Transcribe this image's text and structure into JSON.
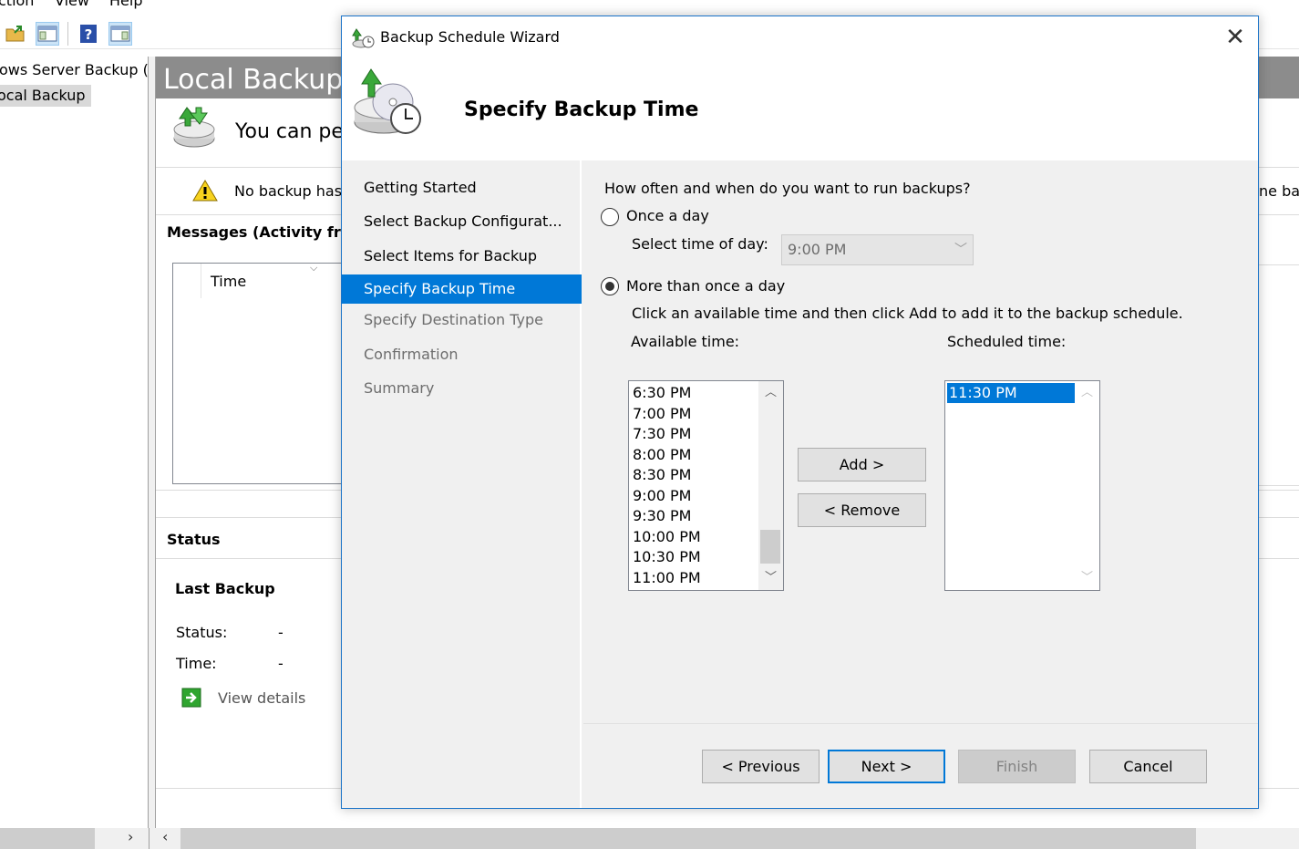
{
  "menubar": {
    "items": [
      "ction",
      "View",
      "Help"
    ]
  },
  "tree": {
    "items": [
      {
        "label": "ows Server Backup (L"
      },
      {
        "label": "ocal Backup"
      }
    ]
  },
  "content": {
    "title": "Local Backup",
    "intro_text": "You can per",
    "warning_text": "No backup has",
    "right_clip_text": "ne ba",
    "messages_heading": "Messages (Activity fro",
    "messages_col_time": "Time",
    "status_heading": "Status",
    "last_backup_heading": "Last Backup",
    "status_label": "Status:",
    "status_value": "-",
    "time_label": "Time:",
    "time_value": "-",
    "view_details": "View details"
  },
  "dialog": {
    "title": "Backup Schedule Wizard",
    "heading": "Specify Backup Time",
    "close_glyph": "✕",
    "nav": [
      {
        "label": "Getting Started",
        "state": "done"
      },
      {
        "label": "Select Backup Configurat...",
        "state": "done"
      },
      {
        "label": "Select Items for Backup",
        "state": "done"
      },
      {
        "label": "Specify Backup Time",
        "state": "current"
      },
      {
        "label": "Specify Destination Type",
        "state": "future"
      },
      {
        "label": "Confirmation",
        "state": "future"
      },
      {
        "label": "Summary",
        "state": "future"
      }
    ],
    "question": "How often and when do you want to run backups?",
    "once_label": "Once a day",
    "select_time_label": "Select time of day:",
    "select_time_value": "9:00 PM",
    "more_label": "More than once a day",
    "instruction": "Click an available time and then click Add to add it to the backup schedule.",
    "available_label": "Available time:",
    "scheduled_label": "Scheduled time:",
    "available_times": [
      "6:30 PM",
      "7:00 PM",
      "7:30 PM",
      "8:00 PM",
      "8:30 PM",
      "9:00 PM",
      "9:30 PM",
      "10:00 PM",
      "10:30 PM",
      "11:00 PM"
    ],
    "scheduled_times": [
      "11:30 PM"
    ],
    "add_button": "Add >",
    "remove_button": "< Remove",
    "previous_button": "< Previous",
    "next_button": "Next >",
    "finish_button": "Finish",
    "cancel_button": "Cancel"
  }
}
